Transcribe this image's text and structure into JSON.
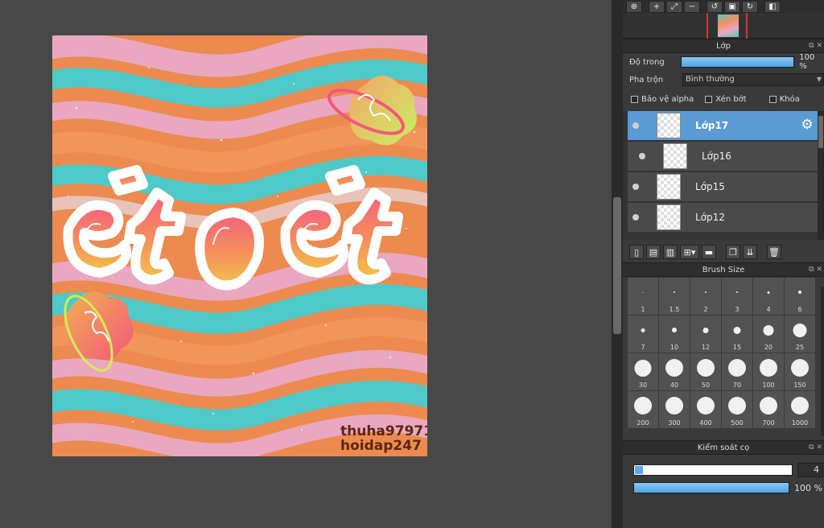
{
  "artwork": {
    "watermark_line1": "thuha97971",
    "watermark_line2": "hoidap247",
    "title_art": "ét o ét"
  },
  "toolbar": {
    "buttons": [
      "zoom-fit-icon",
      "zoom-in-icon",
      "fit-screen-icon",
      "zoom-out-icon",
      "rotate-left-icon",
      "fullscreen-icon",
      "rotate-right-icon",
      "flip-icon"
    ]
  },
  "layer_panel": {
    "title": "Lớp",
    "opacity_label": "Độ trong",
    "opacity_value": "100 %",
    "opacity_fraction": 1.0,
    "blend_label": "Pha trộn",
    "blend_value": "Bình thường",
    "protect_alpha": "Bảo vệ alpha",
    "clipping": "Xén bớt",
    "lock": "Khóa",
    "layers": [
      {
        "name": "Lớp17",
        "selected": true
      },
      {
        "name": "Lớp16",
        "selected": false
      },
      {
        "name": "Lớp15",
        "selected": false
      },
      {
        "name": "Lớp12",
        "selected": false
      }
    ]
  },
  "brush_size_panel": {
    "title": "Brush Size",
    "sizes": [
      "1",
      "1.5",
      "2",
      "3",
      "4",
      "6",
      "7",
      "10",
      "12",
      "15",
      "20",
      "25",
      "30",
      "40",
      "50",
      "70",
      "100",
      "150",
      "200",
      "300",
      "400",
      "500",
      "700",
      "1000"
    ]
  },
  "brush_control_panel": {
    "title": "Kiểm soát cọ",
    "size_value": "4",
    "opacity_value": "100 %"
  },
  "colors": {
    "accent": "#5b9bd5",
    "panel_bg": "#3a3a3a",
    "canvas_bg": "#484848"
  }
}
